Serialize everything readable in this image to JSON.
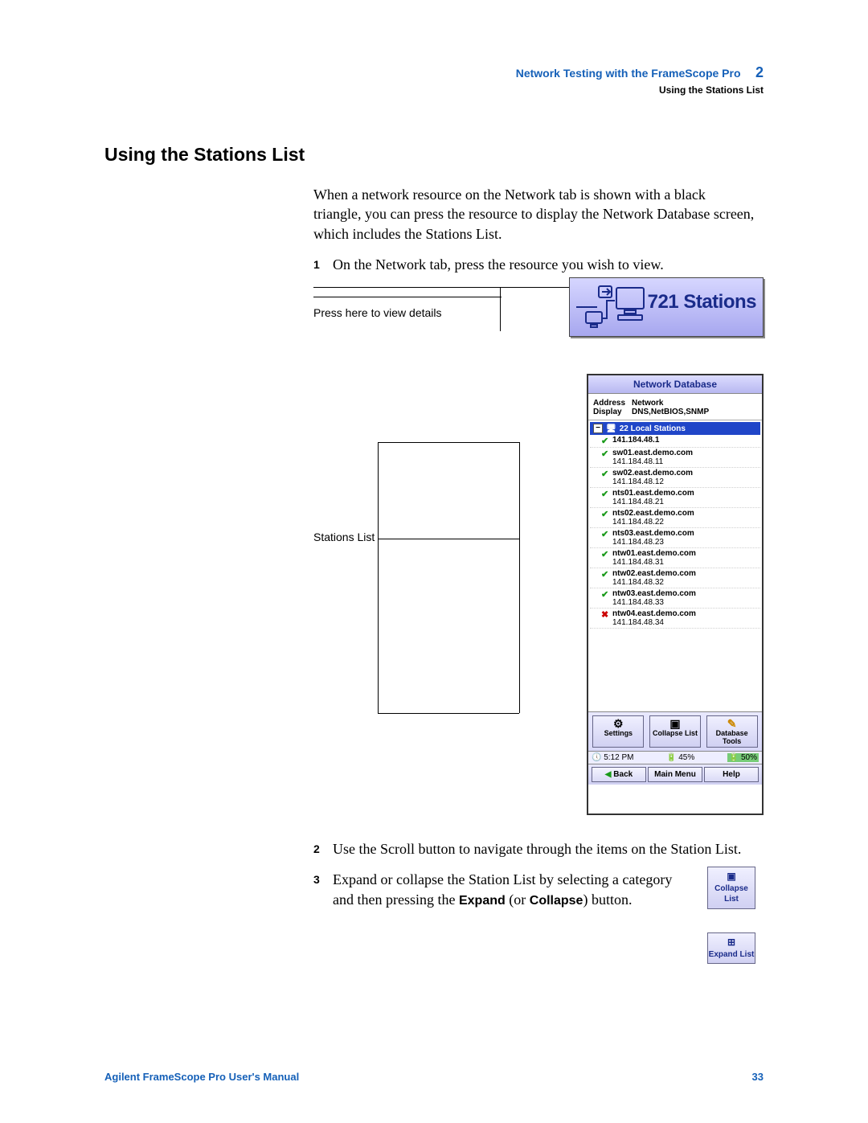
{
  "header": {
    "chapter_title": "Network Testing with the FrameScope Pro",
    "chapter_num": "2",
    "subsection": "Using the Stations List"
  },
  "section_heading": "Using the Stations List",
  "intro_para": "When a network resource on the Network tab is shown with a black triangle, you can press the resource to display the Network Database screen, which includes the Stations List.",
  "steps": {
    "s1_num": "1",
    "s1": "On the Network tab, press the resource you wish to view.",
    "s2_num": "2",
    "s2": "Use the Scroll button to navigate through the items on the Station List.",
    "s3_num": "3",
    "s3_a": "Expand or collapse the Station List by selecting a category and then pressing the ",
    "s3_expand": "Expand",
    "s3_or": " (or ",
    "s3_collapse": "Collapse",
    "s3_b": ") button."
  },
  "fig1": {
    "caption": "Press here to view details",
    "banner_label": "721 Stations"
  },
  "fig2": {
    "caption": "Stations List"
  },
  "device": {
    "title": "Network Database",
    "info": {
      "k1": "Address",
      "v1": "Network",
      "k2": "Display",
      "v2": "DNS,NetBIOS,SNMP"
    },
    "group_label": "22 Local Stations",
    "items": [
      {
        "ok": true,
        "host": "141.184.48.1",
        "ip": ""
      },
      {
        "ok": true,
        "host": "sw01.east.demo.com",
        "ip": "141.184.48.11"
      },
      {
        "ok": true,
        "host": "sw02.east.demo.com",
        "ip": "141.184.48.12"
      },
      {
        "ok": true,
        "host": "nts01.east.demo.com",
        "ip": "141.184.48.21"
      },
      {
        "ok": true,
        "host": "nts02.east.demo.com",
        "ip": "141.184.48.22"
      },
      {
        "ok": true,
        "host": "nts03.east.demo.com",
        "ip": "141.184.48.23"
      },
      {
        "ok": true,
        "host": "ntw01.east.demo.com",
        "ip": "141.184.48.31"
      },
      {
        "ok": true,
        "host": "ntw02.east.demo.com",
        "ip": "141.184.48.32"
      },
      {
        "ok": true,
        "host": "ntw03.east.demo.com",
        "ip": "141.184.48.33"
      },
      {
        "ok": false,
        "host": "ntw04.east.demo.com",
        "ip": "141.184.48.34"
      }
    ],
    "btns": {
      "settings": "Settings",
      "collapse": "Collapse List",
      "tools": "Database Tools"
    },
    "status": {
      "time": "5:12 PM",
      "bat1": "45%",
      "bat2": "50%"
    },
    "nav": {
      "back": "Back",
      "main": "Main Menu",
      "help": "Help"
    }
  },
  "mini": {
    "collapse": "Collapse List",
    "expand": "Expand List"
  },
  "footer": {
    "left": "Agilent FrameScope Pro User's Manual",
    "right": "33"
  }
}
